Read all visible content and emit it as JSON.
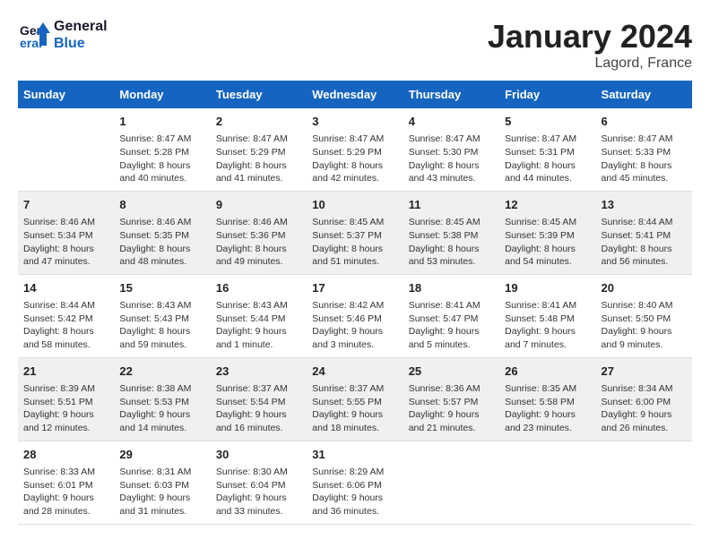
{
  "logo": {
    "line1": "General",
    "line2": "Blue"
  },
  "title": "January 2024",
  "subtitle": "Lagord, France",
  "days_header": [
    "Sunday",
    "Monday",
    "Tuesday",
    "Wednesday",
    "Thursday",
    "Friday",
    "Saturday"
  ],
  "weeks": [
    [
      {
        "num": "",
        "sunrise": "",
        "sunset": "",
        "daylight": ""
      },
      {
        "num": "1",
        "sunrise": "Sunrise: 8:47 AM",
        "sunset": "Sunset: 5:28 PM",
        "daylight": "Daylight: 8 hours and 40 minutes."
      },
      {
        "num": "2",
        "sunrise": "Sunrise: 8:47 AM",
        "sunset": "Sunset: 5:29 PM",
        "daylight": "Daylight: 8 hours and 41 minutes."
      },
      {
        "num": "3",
        "sunrise": "Sunrise: 8:47 AM",
        "sunset": "Sunset: 5:29 PM",
        "daylight": "Daylight: 8 hours and 42 minutes."
      },
      {
        "num": "4",
        "sunrise": "Sunrise: 8:47 AM",
        "sunset": "Sunset: 5:30 PM",
        "daylight": "Daylight: 8 hours and 43 minutes."
      },
      {
        "num": "5",
        "sunrise": "Sunrise: 8:47 AM",
        "sunset": "Sunset: 5:31 PM",
        "daylight": "Daylight: 8 hours and 44 minutes."
      },
      {
        "num": "6",
        "sunrise": "Sunrise: 8:47 AM",
        "sunset": "Sunset: 5:33 PM",
        "daylight": "Daylight: 8 hours and 45 minutes."
      }
    ],
    [
      {
        "num": "7",
        "sunrise": "Sunrise: 8:46 AM",
        "sunset": "Sunset: 5:34 PM",
        "daylight": "Daylight: 8 hours and 47 minutes."
      },
      {
        "num": "8",
        "sunrise": "Sunrise: 8:46 AM",
        "sunset": "Sunset: 5:35 PM",
        "daylight": "Daylight: 8 hours and 48 minutes."
      },
      {
        "num": "9",
        "sunrise": "Sunrise: 8:46 AM",
        "sunset": "Sunset: 5:36 PM",
        "daylight": "Daylight: 8 hours and 49 minutes."
      },
      {
        "num": "10",
        "sunrise": "Sunrise: 8:45 AM",
        "sunset": "Sunset: 5:37 PM",
        "daylight": "Daylight: 8 hours and 51 minutes."
      },
      {
        "num": "11",
        "sunrise": "Sunrise: 8:45 AM",
        "sunset": "Sunset: 5:38 PM",
        "daylight": "Daylight: 8 hours and 53 minutes."
      },
      {
        "num": "12",
        "sunrise": "Sunrise: 8:45 AM",
        "sunset": "Sunset: 5:39 PM",
        "daylight": "Daylight: 8 hours and 54 minutes."
      },
      {
        "num": "13",
        "sunrise": "Sunrise: 8:44 AM",
        "sunset": "Sunset: 5:41 PM",
        "daylight": "Daylight: 8 hours and 56 minutes."
      }
    ],
    [
      {
        "num": "14",
        "sunrise": "Sunrise: 8:44 AM",
        "sunset": "Sunset: 5:42 PM",
        "daylight": "Daylight: 8 hours and 58 minutes."
      },
      {
        "num": "15",
        "sunrise": "Sunrise: 8:43 AM",
        "sunset": "Sunset: 5:43 PM",
        "daylight": "Daylight: 8 hours and 59 minutes."
      },
      {
        "num": "16",
        "sunrise": "Sunrise: 8:43 AM",
        "sunset": "Sunset: 5:44 PM",
        "daylight": "Daylight: 9 hours and 1 minute."
      },
      {
        "num": "17",
        "sunrise": "Sunrise: 8:42 AM",
        "sunset": "Sunset: 5:46 PM",
        "daylight": "Daylight: 9 hours and 3 minutes."
      },
      {
        "num": "18",
        "sunrise": "Sunrise: 8:41 AM",
        "sunset": "Sunset: 5:47 PM",
        "daylight": "Daylight: 9 hours and 5 minutes."
      },
      {
        "num": "19",
        "sunrise": "Sunrise: 8:41 AM",
        "sunset": "Sunset: 5:48 PM",
        "daylight": "Daylight: 9 hours and 7 minutes."
      },
      {
        "num": "20",
        "sunrise": "Sunrise: 8:40 AM",
        "sunset": "Sunset: 5:50 PM",
        "daylight": "Daylight: 9 hours and 9 minutes."
      }
    ],
    [
      {
        "num": "21",
        "sunrise": "Sunrise: 8:39 AM",
        "sunset": "Sunset: 5:51 PM",
        "daylight": "Daylight: 9 hours and 12 minutes."
      },
      {
        "num": "22",
        "sunrise": "Sunrise: 8:38 AM",
        "sunset": "Sunset: 5:53 PM",
        "daylight": "Daylight: 9 hours and 14 minutes."
      },
      {
        "num": "23",
        "sunrise": "Sunrise: 8:37 AM",
        "sunset": "Sunset: 5:54 PM",
        "daylight": "Daylight: 9 hours and 16 minutes."
      },
      {
        "num": "24",
        "sunrise": "Sunrise: 8:37 AM",
        "sunset": "Sunset: 5:55 PM",
        "daylight": "Daylight: 9 hours and 18 minutes."
      },
      {
        "num": "25",
        "sunrise": "Sunrise: 8:36 AM",
        "sunset": "Sunset: 5:57 PM",
        "daylight": "Daylight: 9 hours and 21 minutes."
      },
      {
        "num": "26",
        "sunrise": "Sunrise: 8:35 AM",
        "sunset": "Sunset: 5:58 PM",
        "daylight": "Daylight: 9 hours and 23 minutes."
      },
      {
        "num": "27",
        "sunrise": "Sunrise: 8:34 AM",
        "sunset": "Sunset: 6:00 PM",
        "daylight": "Daylight: 9 hours and 26 minutes."
      }
    ],
    [
      {
        "num": "28",
        "sunrise": "Sunrise: 8:33 AM",
        "sunset": "Sunset: 6:01 PM",
        "daylight": "Daylight: 9 hours and 28 minutes."
      },
      {
        "num": "29",
        "sunrise": "Sunrise: 8:31 AM",
        "sunset": "Sunset: 6:03 PM",
        "daylight": "Daylight: 9 hours and 31 minutes."
      },
      {
        "num": "30",
        "sunrise": "Sunrise: 8:30 AM",
        "sunset": "Sunset: 6:04 PM",
        "daylight": "Daylight: 9 hours and 33 minutes."
      },
      {
        "num": "31",
        "sunrise": "Sunrise: 8:29 AM",
        "sunset": "Sunset: 6:06 PM",
        "daylight": "Daylight: 9 hours and 36 minutes."
      },
      {
        "num": "",
        "sunrise": "",
        "sunset": "",
        "daylight": ""
      },
      {
        "num": "",
        "sunrise": "",
        "sunset": "",
        "daylight": ""
      },
      {
        "num": "",
        "sunrise": "",
        "sunset": "",
        "daylight": ""
      }
    ]
  ]
}
